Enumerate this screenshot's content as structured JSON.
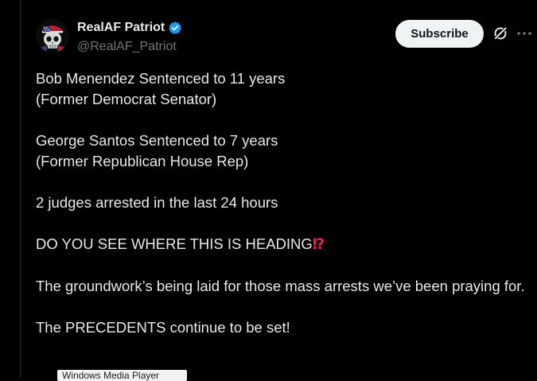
{
  "author": {
    "display_name": "RealAF Patriot",
    "handle": "@RealAF_Patriot",
    "verified": true
  },
  "actions": {
    "subscribe_label": "Subscribe",
    "grok_icon": "grok-icon",
    "more_icon": "more-icon"
  },
  "tweet": {
    "line1": "Bob Menendez Sentenced to 11 years",
    "line2": "(Former Democrat Senator)",
    "line3": "George Santos Sentenced to 7 years",
    "line4": "(Former Republican House Rep)",
    "line5": "2 judges arrested in the last 24 hours",
    "line6": "DO YOU SEE WHERE THIS IS HEADING",
    "line6_emoji": "⁉",
    "line7": "The groundwork’s being laid for those mass arrests we’ve been praying for.",
    "line8": "The PRECEDENTS continue to be set!"
  },
  "overlay": {
    "tooltip_text": "Windows Media Player"
  },
  "colors": {
    "background": "#000000",
    "text": "#e7e9ea",
    "secondary_text": "#71767b",
    "verified_blue": "#1d9bf0",
    "subscribe_bg": "#eff3f4",
    "emoji_red": "#e0245e"
  }
}
